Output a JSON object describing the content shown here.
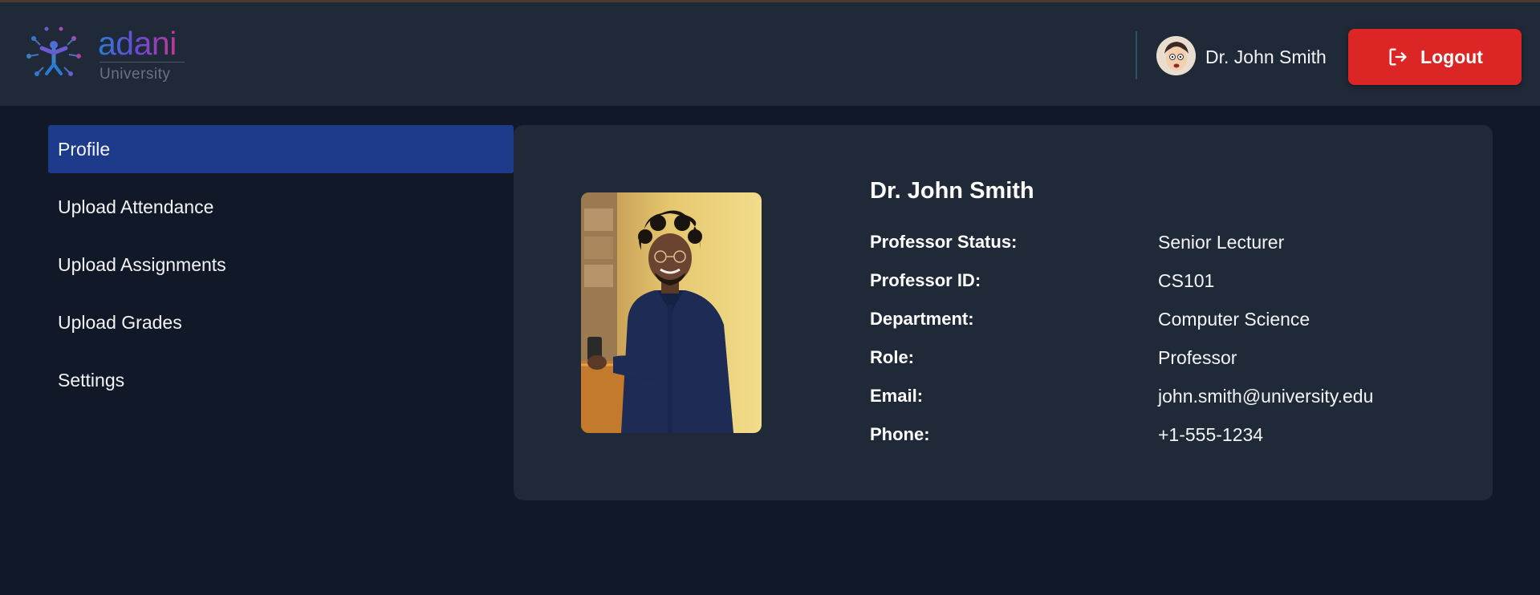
{
  "brand": {
    "name": "adani",
    "subtitle": "University",
    "colors": {
      "blue": "#2b7bd6",
      "purple": "#6b4bd1",
      "magenta": "#c2379a"
    }
  },
  "header": {
    "user_name": "Dr. John Smith",
    "logout_label": "Logout",
    "logout_icon": "logout-arrow-icon",
    "avatar_icon": "cartoon-avatar"
  },
  "sidebar": {
    "items": [
      {
        "label": "Profile",
        "active": true
      },
      {
        "label": "Upload Attendance",
        "active": false
      },
      {
        "label": "Upload Assignments",
        "active": false
      },
      {
        "label": "Upload Grades",
        "active": false
      },
      {
        "label": "Settings",
        "active": false
      }
    ]
  },
  "profile": {
    "name": "Dr. John Smith",
    "fields": [
      {
        "label": "Professor Status:",
        "value": "Senior Lecturer"
      },
      {
        "label": "Professor ID:",
        "value": "CS101"
      },
      {
        "label": "Department:",
        "value": "Computer Science"
      },
      {
        "label": "Role:",
        "value": "Professor"
      },
      {
        "label": "Email:",
        "value": "john.smith@university.edu"
      },
      {
        "label": "Phone:",
        "value": "+1-555-1234"
      }
    ]
  },
  "colors": {
    "page_bg": "#111827",
    "panel_bg": "#1f2937",
    "active_nav": "#1e3a8a",
    "logout_bg": "#dc2626"
  }
}
